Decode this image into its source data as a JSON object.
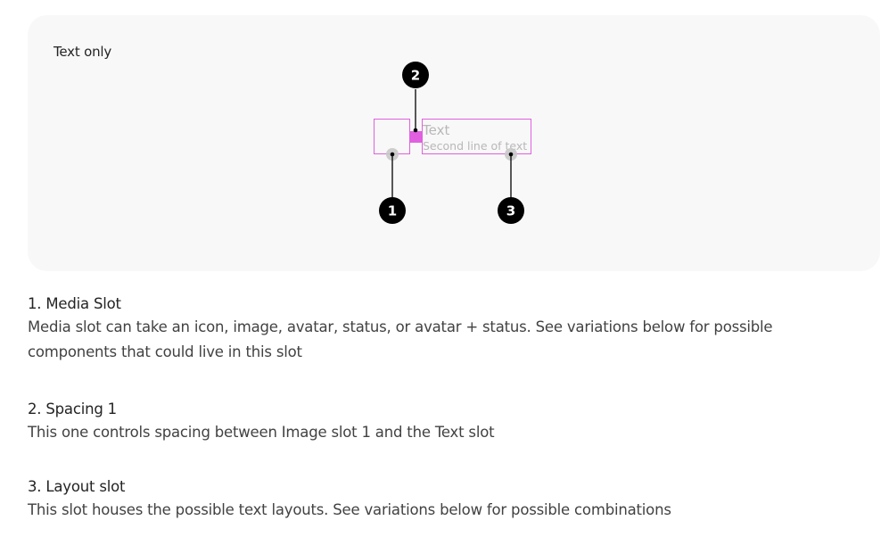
{
  "card": {
    "title": "Text only"
  },
  "diagram": {
    "text_slot": {
      "primary": "Text",
      "secondary": "Second line of text"
    },
    "markers": [
      "1",
      "2",
      "3"
    ],
    "colors": {
      "slot_outline": "#e060e0",
      "spacing_fill": "#e060e0",
      "marker_fill": "#000000",
      "anchor_dot": "#c8c8c8"
    }
  },
  "sections": [
    {
      "title": "1. Media Slot",
      "body": "Media slot can take an icon, image, avatar, status, or avatar + status. See variations below for possible components that could live in this slot"
    },
    {
      "title": "2. Spacing 1",
      "body": "This one controls spacing between Image slot 1 and the Text slot"
    },
    {
      "title": "3. Layout slot",
      "body": "This slot houses the possible text layouts. See variations below for possible combinations"
    }
  ]
}
